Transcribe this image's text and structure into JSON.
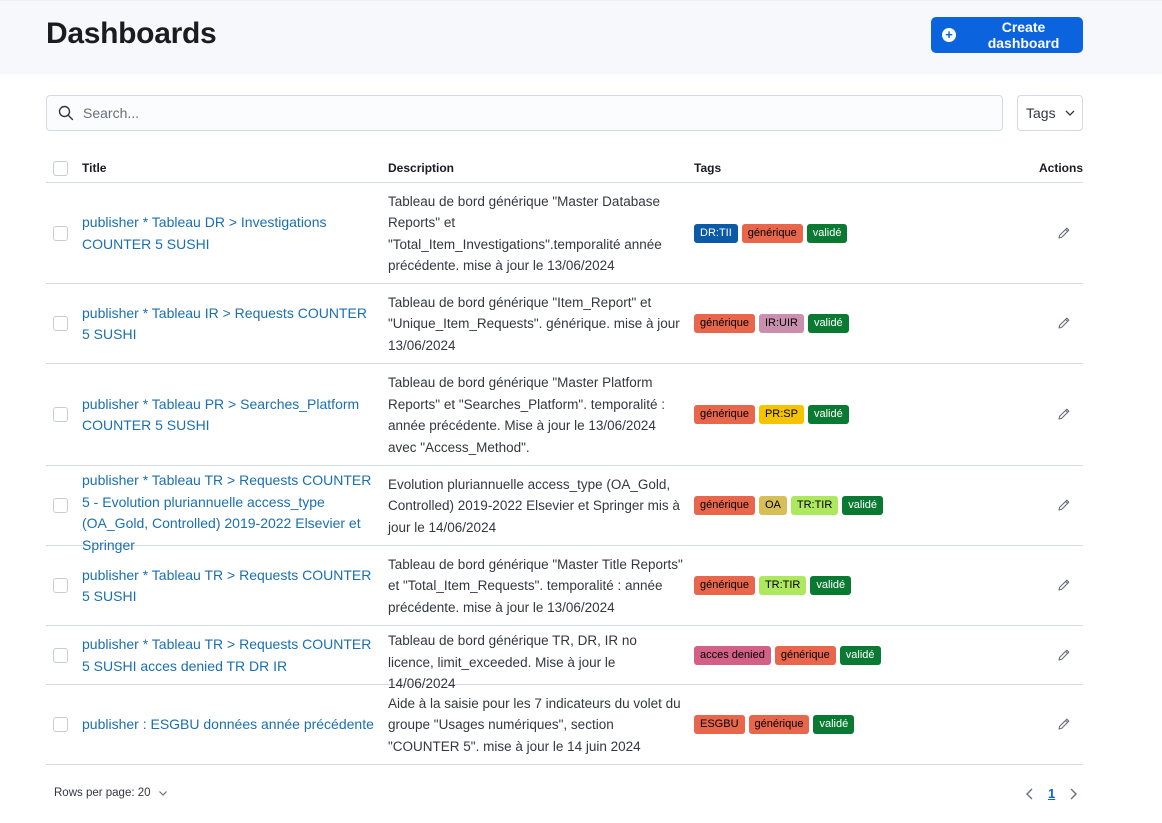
{
  "header": {
    "title": "Dashboards",
    "create_label": "Create dashboard"
  },
  "search": {
    "placeholder": "Search...",
    "value": ""
  },
  "tags_filter": {
    "label": "Tags"
  },
  "columns": {
    "title": "Title",
    "description": "Description",
    "tags": "Tags",
    "actions": "Actions"
  },
  "rows": [
    {
      "title": "publisher * Tableau DR > Investigations COUNTER 5 SUSHI",
      "description": "Tableau de bord générique \"Master Database Reports\" et \"Total_Item_Investigations\".temporalité année précédente. mise à jour le 13/06/2024",
      "tags": [
        {
          "label": "DR:TII",
          "bg": "#0b5aa7",
          "fg": "#ffffff"
        },
        {
          "label": "générique",
          "bg": "#e7664c",
          "fg": "#000000"
        },
        {
          "label": "validé",
          "bg": "#0a7a32",
          "fg": "#ffffff"
        }
      ]
    },
    {
      "title": "publisher * Tableau IR > Requests COUNTER 5 SUSHI",
      "description": "Tableau de bord générique \"Item_Report\" et \"Unique_Item_Requests\". générique. mise à jour 13/06/2024",
      "tags": [
        {
          "label": "générique",
          "bg": "#e7664c",
          "fg": "#000000"
        },
        {
          "label": "IR:UIR",
          "bg": "#ca8eae",
          "fg": "#000000"
        },
        {
          "label": "validé",
          "bg": "#0a7a32",
          "fg": "#ffffff"
        }
      ]
    },
    {
      "title": "publisher * Tableau PR > Searches_Platform COUNTER 5 SUSHI",
      "description": "Tableau de bord générique \"Master Platform Reports\" et \"Searches_Platform\". temporalité : année précédente. Mise à jour le 13/06/2024 avec \"Access_Method\".",
      "tags": [
        {
          "label": "générique",
          "bg": "#e7664c",
          "fg": "#000000"
        },
        {
          "label": "PR:SP",
          "bg": "#f5c400",
          "fg": "#000000"
        },
        {
          "label": "validé",
          "bg": "#0a7a32",
          "fg": "#ffffff"
        }
      ]
    },
    {
      "title": "publisher * Tableau TR > Requests COUNTER 5 - Evolution pluriannuelle access_type (OA_Gold, Controlled) 2019-2022 Elsevier et Springer",
      "description": "Evolution pluriannuelle access_type (OA_Gold, Controlled) 2019-2022 Elsevier et Springer mis à jour le 14/06/2024",
      "tags": [
        {
          "label": "générique",
          "bg": "#e7664c",
          "fg": "#000000"
        },
        {
          "label": "OA",
          "bg": "#d6bf57",
          "fg": "#000000"
        },
        {
          "label": "TR:TIR",
          "bg": "#aee85f",
          "fg": "#000000"
        },
        {
          "label": "validé",
          "bg": "#0a7a32",
          "fg": "#ffffff"
        }
      ]
    },
    {
      "title": "publisher * Tableau TR > Requests COUNTER 5 SUSHI",
      "description": "Tableau de bord générique \"Master Title Reports\" et \"Total_Item_Requests\". temporalité : année précédente. mise à jour le 13/06/2024",
      "tags": [
        {
          "label": "générique",
          "bg": "#e7664c",
          "fg": "#000000"
        },
        {
          "label": "TR:TIR",
          "bg": "#aee85f",
          "fg": "#000000"
        },
        {
          "label": "validé",
          "bg": "#0a7a32",
          "fg": "#ffffff"
        }
      ]
    },
    {
      "title": "publisher * Tableau TR > Requests COUNTER 5 SUSHI acces denied TR DR IR",
      "description": "Tableau de bord générique TR, DR, IR no licence, limit_exceeded. Mise à jour le 14/06/2024",
      "tags": [
        {
          "label": "acces denied",
          "bg": "#d36086",
          "fg": "#000000"
        },
        {
          "label": "générique",
          "bg": "#e7664c",
          "fg": "#000000"
        },
        {
          "label": "validé",
          "bg": "#0a7a32",
          "fg": "#ffffff"
        }
      ]
    },
    {
      "title": "publisher : ESGBU données année précédente",
      "description": "Aide à la saisie pour les 7 indicateurs du volet du groupe \"Usages numériques\", section \"COUNTER 5\". mise à jour le 14 juin 2024",
      "tags": [
        {
          "label": "ESGBU",
          "bg": "#e7664c",
          "fg": "#000000"
        },
        {
          "label": "générique",
          "bg": "#e7664c",
          "fg": "#000000"
        },
        {
          "label": "validé",
          "bg": "#0a7a32",
          "fg": "#ffffff"
        }
      ]
    }
  ],
  "footer": {
    "rows_per_page": "Rows per page: 20",
    "current_page": "1"
  },
  "colors": {
    "primary": "#0b64dd",
    "link": "#1a6fb0",
    "header_bg": "#f7f8fc"
  }
}
